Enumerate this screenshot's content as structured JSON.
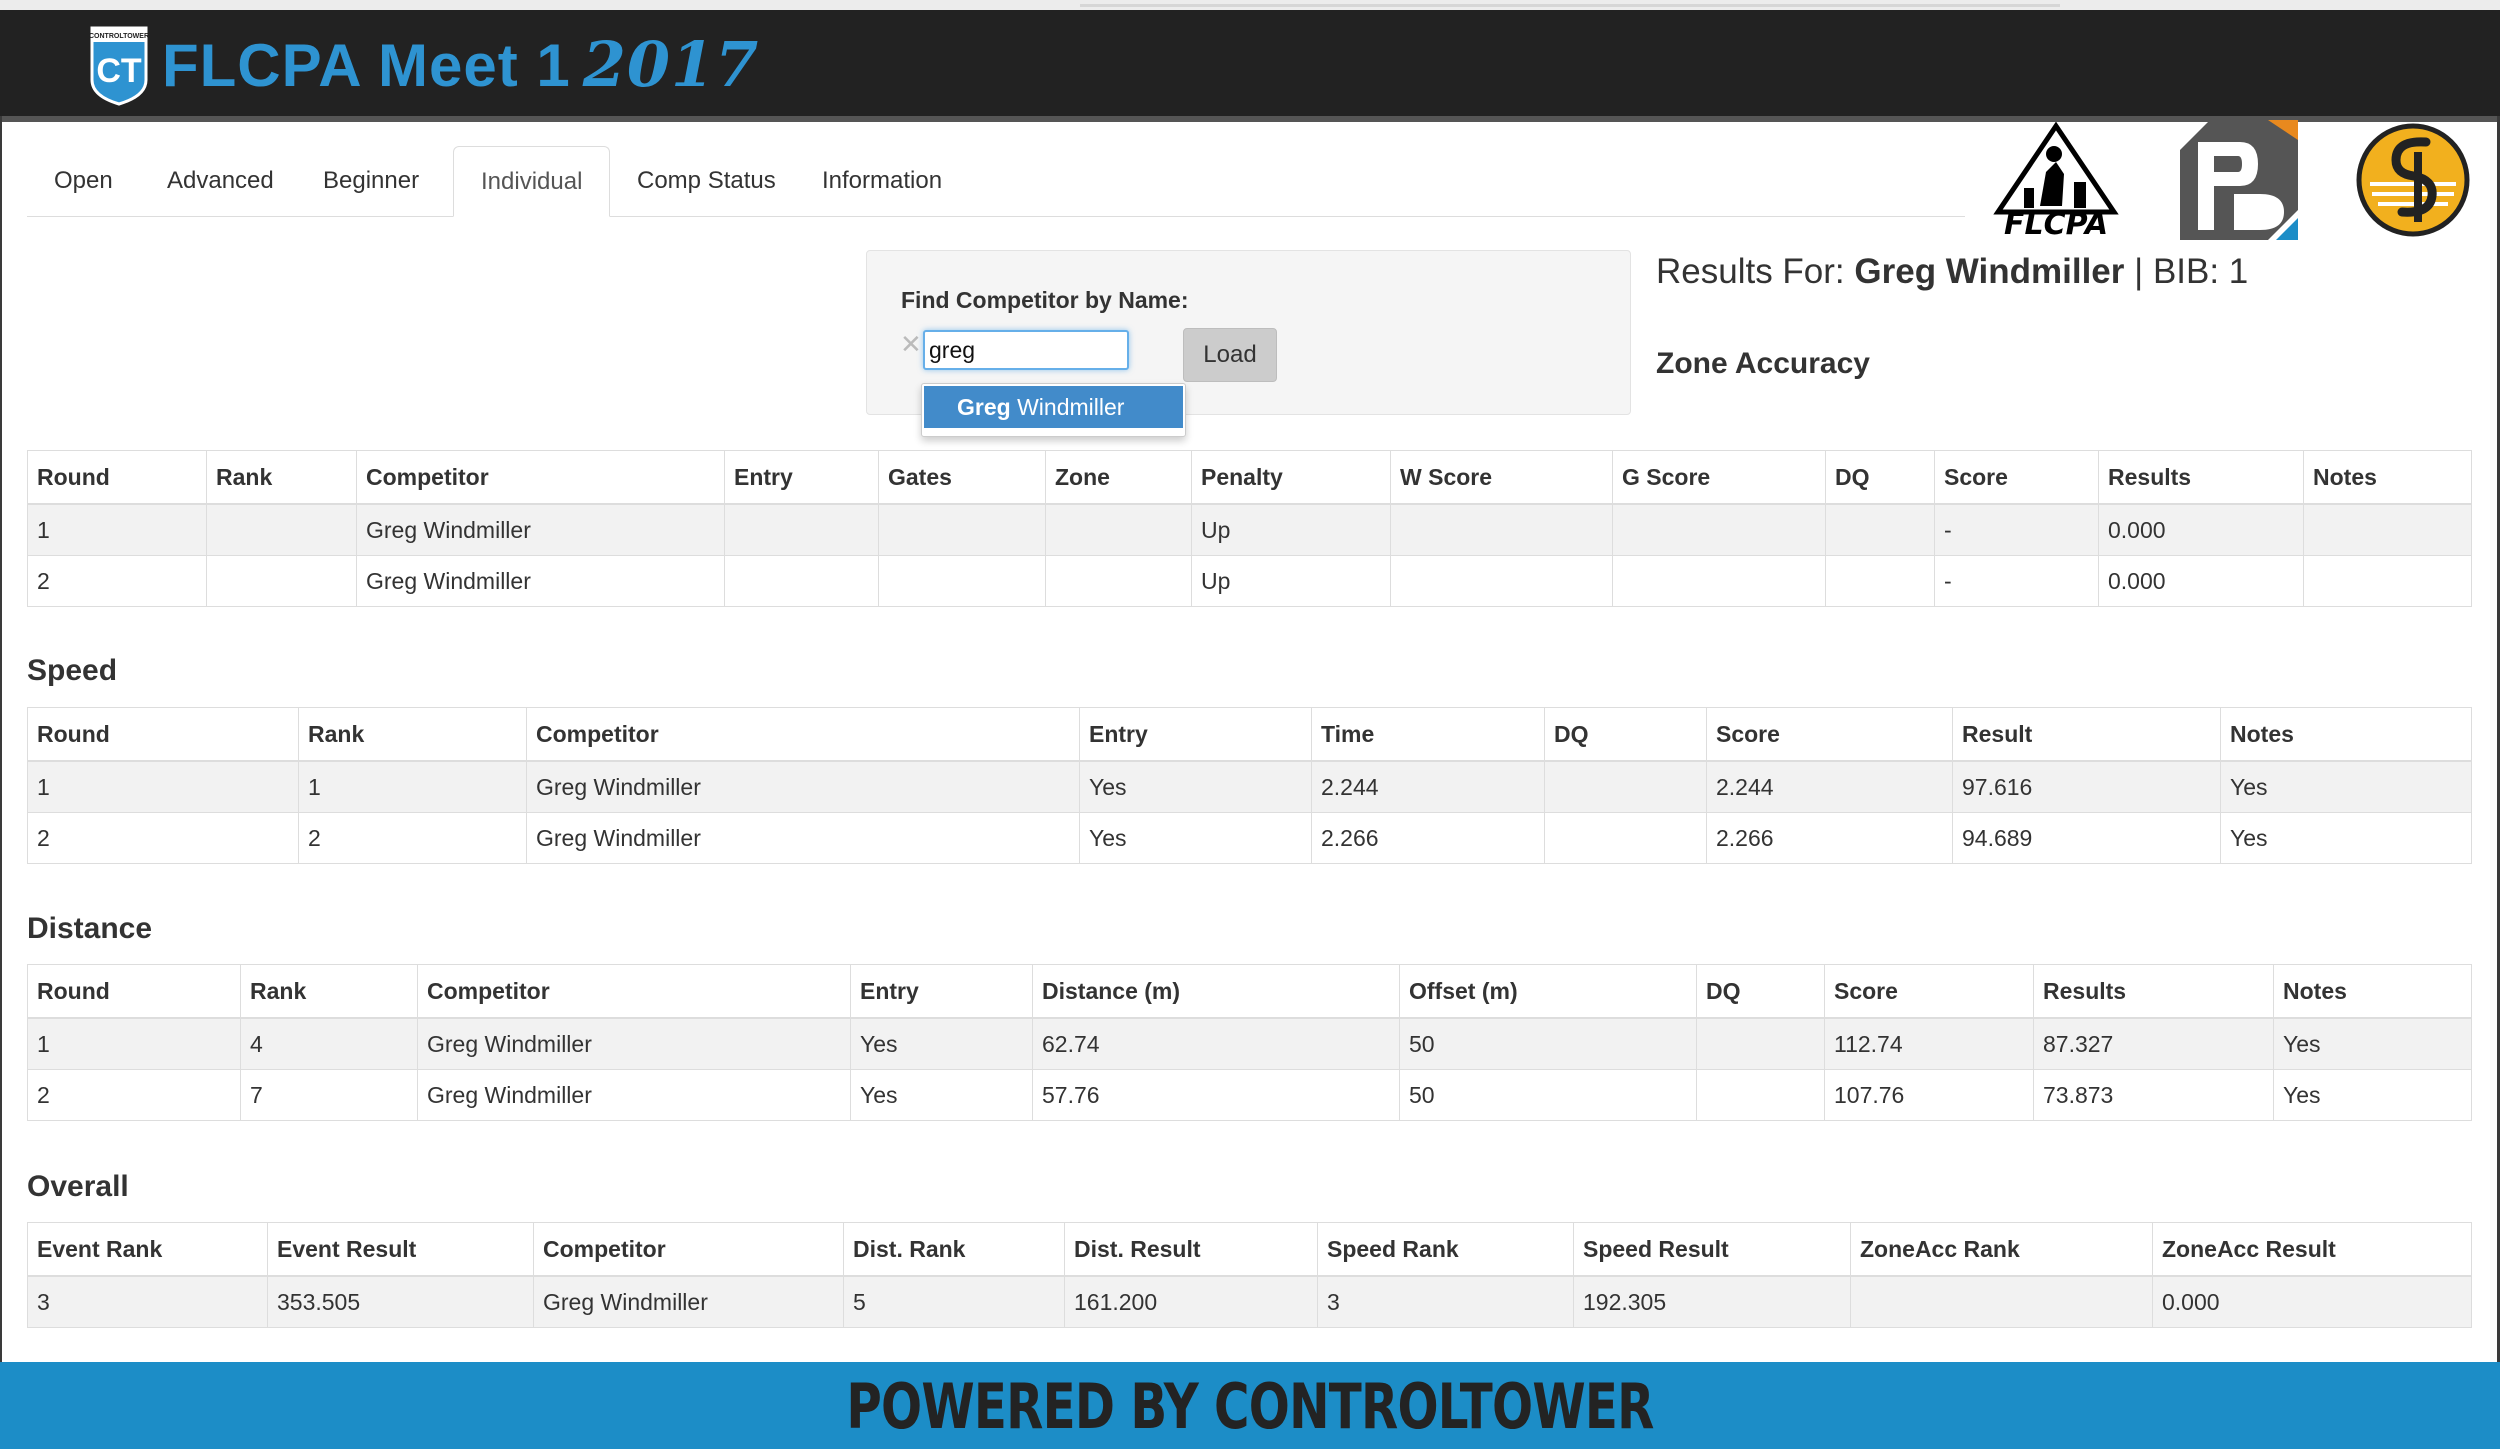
{
  "header": {
    "title": "FLCPA Meet 1",
    "year": "2017",
    "logo_text": "CONTROLTOWER"
  },
  "colors": {
    "header_bg": "#222222",
    "accent": "#2e93d1",
    "footer_bg": "#1c8dc7",
    "selected_item": "#428bca"
  },
  "tabs": [
    {
      "label": "Open",
      "active": false
    },
    {
      "label": "Advanced",
      "active": false
    },
    {
      "label": "Beginner",
      "active": false
    },
    {
      "label": "Individual",
      "active": true
    },
    {
      "label": "Comp Status",
      "active": false
    },
    {
      "label": "Information",
      "active": false
    }
  ],
  "sponsors": {
    "flcpa_text": "FLCPA",
    "icons": [
      "flcpa-logo-icon",
      "pd-logo-icon",
      "sp-logo-icon"
    ]
  },
  "search": {
    "label": "Find Competitor by Name:",
    "value": "greg",
    "clear_icon": "clear-icon",
    "load_label": "Load",
    "suggestion_match": "Greg",
    "suggestion_rest": " Windmiller"
  },
  "results": {
    "prefix": "Results For: ",
    "name": "Greg Windmiller",
    "bib": " | BIB: 1"
  },
  "zone_accuracy": {
    "title": "Zone Accuracy",
    "headers": [
      "Round",
      "Rank",
      "Competitor",
      "Entry",
      "Gates",
      "Zone",
      "Penalty",
      "W Score",
      "G Score",
      "DQ",
      "Score",
      "Results",
      "Notes"
    ],
    "rows": [
      [
        "1",
        "",
        "Greg Windmiller",
        "",
        "",
        "",
        "Up",
        "",
        "",
        "",
        "-",
        "0.000",
        ""
      ],
      [
        "2",
        "",
        "Greg Windmiller",
        "",
        "",
        "",
        "Up",
        "",
        "",
        "",
        "-",
        "0.000",
        ""
      ]
    ]
  },
  "speed": {
    "title": "Speed",
    "headers": [
      "Round",
      "Rank",
      "Competitor",
      "Entry",
      "Time",
      "DQ",
      "Score",
      "Result",
      "Notes"
    ],
    "rows": [
      [
        "1",
        "1",
        "Greg Windmiller",
        "Yes",
        "2.244",
        "",
        "2.244",
        "97.616",
        "Yes"
      ],
      [
        "2",
        "2",
        "Greg Windmiller",
        "Yes",
        "2.266",
        "",
        "2.266",
        "94.689",
        "Yes"
      ]
    ]
  },
  "distance": {
    "title": "Distance",
    "headers": [
      "Round",
      "Rank",
      "Competitor",
      "Entry",
      "Distance (m)",
      "Offset (m)",
      "DQ",
      "Score",
      "Results",
      "Notes"
    ],
    "rows": [
      [
        "1",
        "4",
        "Greg Windmiller",
        "Yes",
        "62.74",
        "50",
        "",
        "112.74",
        "87.327",
        "Yes"
      ],
      [
        "2",
        "7",
        "Greg Windmiller",
        "Yes",
        "57.76",
        "50",
        "",
        "107.76",
        "73.873",
        "Yes"
      ]
    ]
  },
  "overall": {
    "title": "Overall",
    "headers": [
      "Event Rank",
      "Event Result",
      "Competitor",
      "Dist. Rank",
      "Dist. Result",
      "Speed Rank",
      "Speed Result",
      "ZoneAcc Rank",
      "ZoneAcc Result"
    ],
    "rows": [
      [
        "3",
        "353.505",
        "Greg Windmiller",
        "5",
        "161.200",
        "3",
        "192.305",
        "",
        "0.000"
      ]
    ]
  },
  "footer": {
    "text": "POWERED BY CONTROLTOWER"
  }
}
